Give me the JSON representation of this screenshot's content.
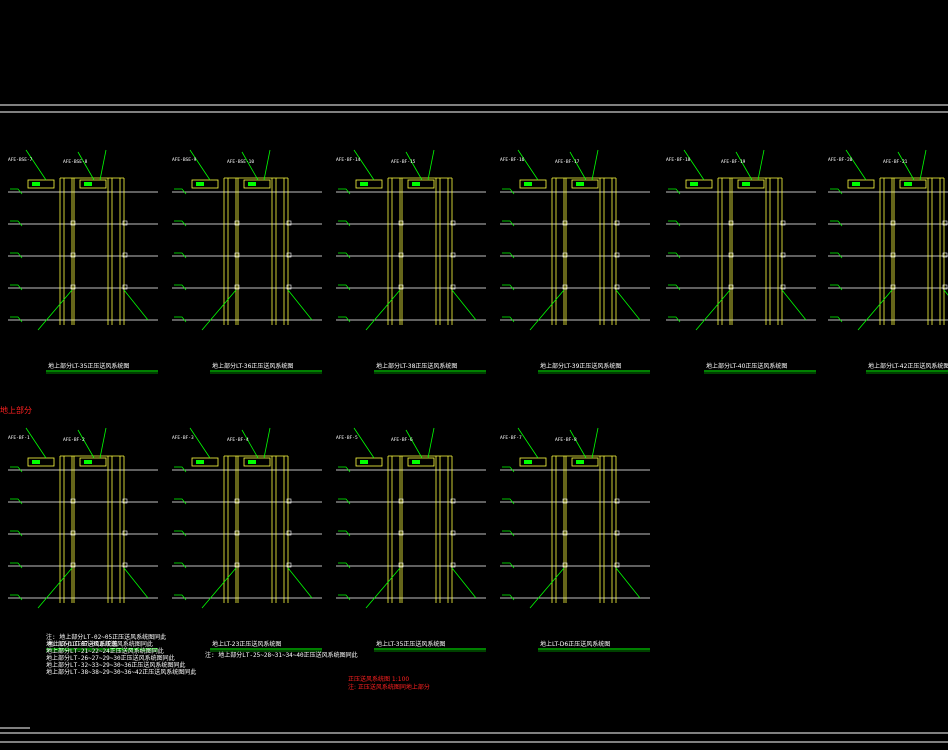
{
  "diagrams": [
    {
      "title": "地上部分LT-35正压送风系统图",
      "tags": [
        "AFE-BSE-7",
        "AFE-BSE-8"
      ]
    },
    {
      "title": "地上部分LT-36正压送风系统图",
      "tags": [
        "AFE-BSE-9",
        "AFE-BSE-10"
      ]
    },
    {
      "title": "地上部分LT-38正压送风系统图",
      "tags": [
        "AFE-BF-14",
        "AFE-BF-15"
      ]
    },
    {
      "title": "地上部分LT-39正压送风系统图",
      "tags": [
        "AFE-BF-16",
        "AFE-BF-17"
      ]
    },
    {
      "title": "地上部分LT-40正压送风系统图",
      "tags": [
        "AFE-BF-18",
        "AFE-BF-19"
      ]
    },
    {
      "title": "地上部分LT-42正压送风系统图",
      "tags": [
        "AFE-BF-20",
        "AFE-BF-21"
      ]
    },
    {
      "title": "地上LT-01正压送风系统图",
      "tags": [
        "AFE-BF-1",
        "AFE-BF-2"
      ]
    },
    {
      "title": "地上LT-23正压送风系统图",
      "tags": [
        "AFE-BF-3",
        "AFE-BF-4"
      ]
    },
    {
      "title": "地上LT-35正压送风系统图",
      "tags": [
        "AFE-BF-5",
        "AFE-BF-6"
      ]
    },
    {
      "title": "地上LT-D6正压送风系统图",
      "tags": [
        "AFE-BF-7",
        "AFE-BF-8"
      ]
    }
  ],
  "notes_left": [
    "注: 地上部分LT-02~05正压送风系统图同此",
    "地上部分LT-07~09正压送风系统图同此",
    "地上部分LT-21~22~24正压送风系统图同此",
    "地上部分LT-26~27~29~30正压送风系统图同此",
    "地上部分LT-32~33~29~30~36正压送风系统图同此",
    "地上部分LT-38~38~29~30~36~42正压送风系统图同此"
  ],
  "note_mid": "注: 地上部分LT-25~28~31~34~40正压送风系统图同此",
  "red_notes": [
    "正压送风系统图 1:100",
    "注: 正压送风系统图同地上部分"
  ],
  "corner_label": "地上部分",
  "colors": {
    "wall": "#ffff40",
    "leader": "#00ff00",
    "line": "#ffffff",
    "red": "#ff2020"
  }
}
